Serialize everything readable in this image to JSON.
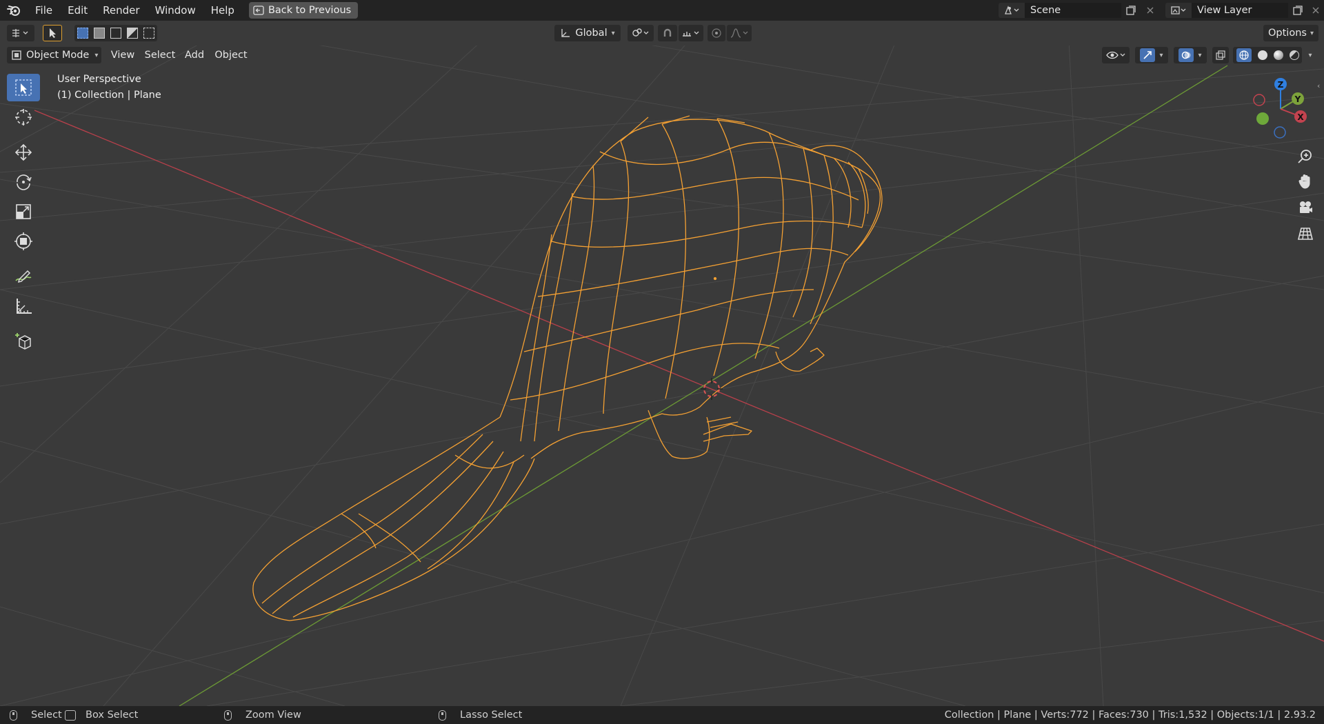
{
  "topbar": {
    "menus": [
      "File",
      "Edit",
      "Render",
      "Window",
      "Help"
    ],
    "back_button": "Back to Previous",
    "scene_name": "Scene",
    "view_layer_name": "View Layer"
  },
  "tool_header": {
    "orientation": "Global",
    "options": "Options"
  },
  "viewport_header": {
    "mode": "Object Mode",
    "menus": [
      "View",
      "Select",
      "Add",
      "Object"
    ]
  },
  "overlay": {
    "perspective": "User Perspective",
    "collection": "(1) Collection | Plane"
  },
  "gizmo": {
    "z": "Z",
    "y": "Y",
    "x": "X"
  },
  "statusbar": {
    "select": "Select",
    "box_select": "Box Select",
    "zoom_view": "Zoom View",
    "lasso_select": "Lasso Select",
    "stats": "Collection | Plane | Verts:772 | Faces:730 | Tris:1,532 | Objects:1/1 | 2.93.2"
  },
  "colors": {
    "accent": "#4772b3",
    "selection": "#f5a133",
    "x_axis": "#c3434f",
    "y_axis": "#7da33b"
  }
}
